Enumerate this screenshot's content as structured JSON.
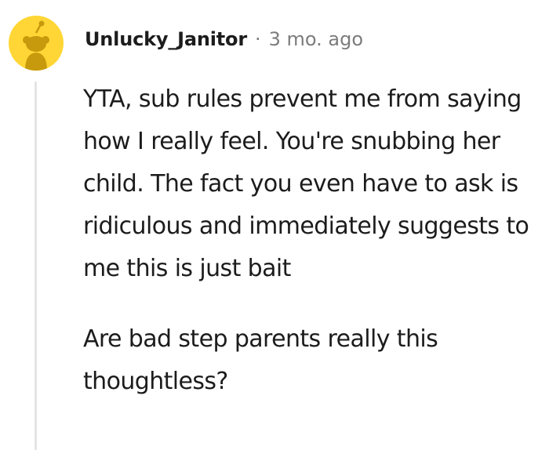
{
  "comment": {
    "author": "Unlucky_Janitor",
    "separator": "·",
    "timestamp": "3 mo. ago",
    "avatar": {
      "icon": "snoo-avatar-icon",
      "background": "#ffd635",
      "figure_color": "#c69a0c"
    },
    "paragraphs": [
      "YTA, sub rules prevent me from saying how I really feel. You're snubbing her child. The fact you even have to ask is ridiculous and immediately suggests to me this is just bait",
      "Are bad step parents really this thoughtless?"
    ]
  }
}
